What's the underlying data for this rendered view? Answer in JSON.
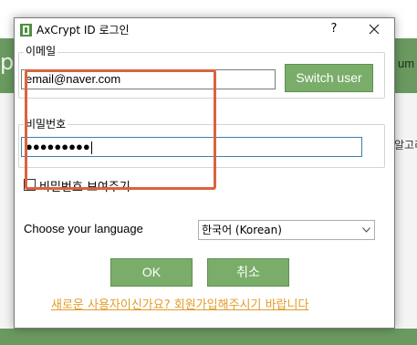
{
  "background_app": {
    "left_fragment": "p",
    "right_fragment": "um",
    "right_text_fragment": "알고리"
  },
  "dialog": {
    "title": "AxCrypt ID 로그인",
    "help_label": "?",
    "close_label": "✕"
  },
  "email_group": {
    "label": "이메일",
    "value": "email@naver.com",
    "switch_user_label": "Switch user"
  },
  "password_group": {
    "label": "비밀번호",
    "masked_value": "●●●●●●●●●"
  },
  "show_password": {
    "label": "비밀번호 보여주기",
    "checked": false
  },
  "language": {
    "label": "Choose your language",
    "selected": "한국어 (Korean)"
  },
  "buttons": {
    "ok_label": "OK",
    "cancel_label": "취소"
  },
  "signup_link": "새로운 사용자이신가요? 회원가입해주시기 바랍니다",
  "colors": {
    "accent_green": "#7aad6a",
    "highlight_orange": "#d9643d",
    "link_orange": "#e39c2a"
  }
}
